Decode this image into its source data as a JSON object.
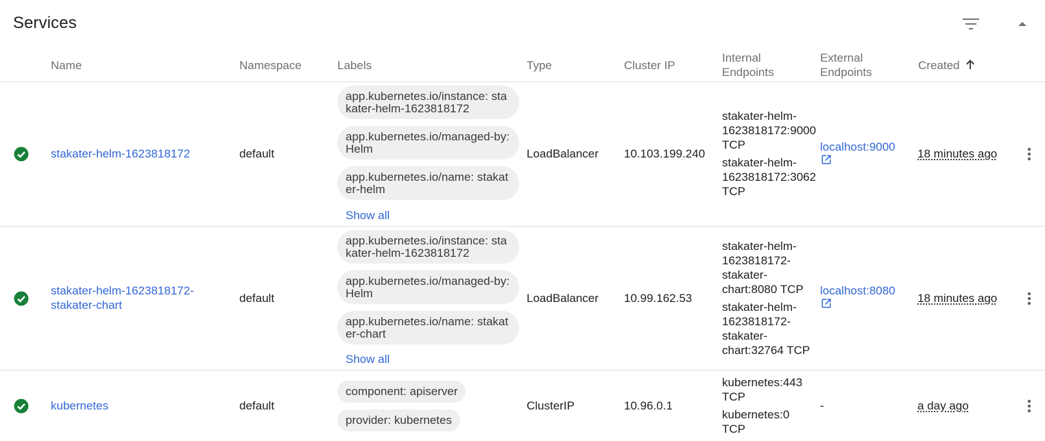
{
  "card": {
    "title": "Services",
    "columns": {
      "name": "Name",
      "namespace": "Namespace",
      "labels": "Labels",
      "type": "Type",
      "cluster_ip": "Cluster IP",
      "internal_endpoints_1": "Internal",
      "internal_endpoints_2": "Endpoints",
      "external_endpoints_1": "External",
      "external_endpoints_2": "Endpoints",
      "created": "Created"
    }
  },
  "rows": [
    {
      "status": "ok",
      "name": "stakater-helm-1623818172",
      "namespace": "default",
      "labels": [
        "app.kubernetes.io/instance: stakater-helm-1623818172",
        "app.kubernetes.io/managed-by: Helm",
        "app.kubernetes.io/name: stakater-helm"
      ],
      "show_all": "Show all",
      "type": "LoadBalancer",
      "cluster_ip": "10.103.199.240",
      "internal_endpoints": [
        [
          "stakater-helm-",
          "1623818172:9000",
          "TCP"
        ],
        [
          "stakater-helm-",
          "1623818172:3062",
          "TCP"
        ]
      ],
      "external_endpoint": "localhost:9000",
      "created": "18 minutes ago"
    },
    {
      "status": "ok",
      "name_line1": "stakater-helm-1623818172-",
      "name_line2": "stakater-chart",
      "namespace": "default",
      "labels": [
        "app.kubernetes.io/instance: stakater-helm-1623818172",
        "app.kubernetes.io/managed-by: Helm",
        "app.kubernetes.io/name: stakater-chart"
      ],
      "show_all": "Show all",
      "type": "LoadBalancer",
      "cluster_ip": "10.99.162.53",
      "internal_endpoints": [
        [
          "stakater-helm-",
          "1623818172-",
          "stakater-",
          "chart:8080 TCP"
        ],
        [
          "stakater-helm-",
          "1623818172-",
          "stakater-",
          "chart:32764 TCP"
        ]
      ],
      "external_endpoint": "localhost:8080",
      "created": "18 minutes ago"
    },
    {
      "status": "ok",
      "name": "kubernetes",
      "namespace": "default",
      "labels": [
        "component: apiserver",
        "provider: kubernetes"
      ],
      "type": "ClusterIP",
      "cluster_ip": "10.96.0.1",
      "internal_endpoints": [
        [
          "kubernetes:443",
          "TCP"
        ],
        [
          "kubernetes:0",
          "TCP"
        ]
      ],
      "external_endpoint": "-",
      "created": "a day ago"
    }
  ],
  "icons": {
    "filter": "filter-icon",
    "collapse": "chevron-up-icon",
    "sort": "arrow-up-icon",
    "status": "check-circle-icon",
    "open": "open-in-new-icon",
    "menu": "more-vert-icon"
  },
  "colors": {
    "link": "#3367d6",
    "success": "#188038",
    "chip": "#efefef",
    "header_text": "#6f6f6f"
  }
}
